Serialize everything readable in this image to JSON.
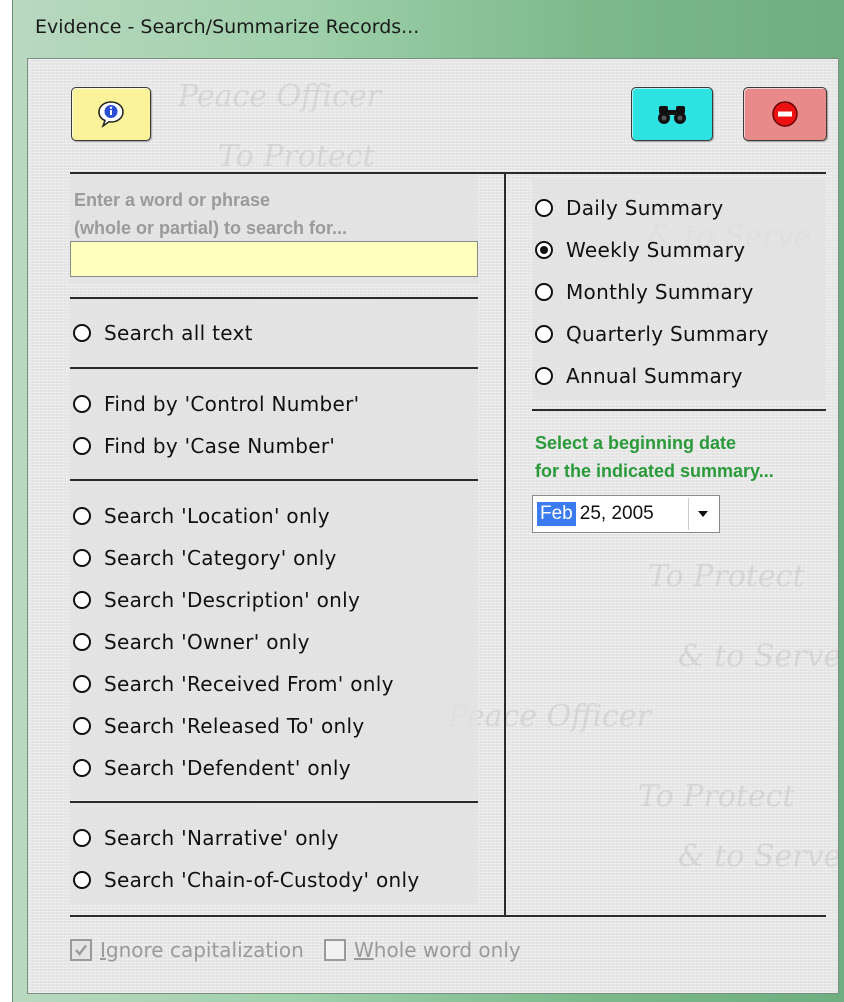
{
  "window": {
    "title": "Evidence - Search/Summarize Records..."
  },
  "toolbar": {
    "info_icon": "info-speech-bubble-icon",
    "find_icon": "binoculars-icon",
    "close_icon": "stop-sign-icon"
  },
  "search": {
    "hint": "Enter a word or phrase\n(whole or partial) to search for...",
    "value": "",
    "placeholder": ""
  },
  "options": {
    "group_all": [
      {
        "label": "Search all text",
        "selected": false
      }
    ],
    "group_numbers": [
      {
        "label": "Find by 'Control Number'",
        "selected": false
      },
      {
        "label": "Find by 'Case Number'",
        "selected": false
      }
    ],
    "group_fields": [
      {
        "label": "Search 'Location' only",
        "selected": false
      },
      {
        "label": "Search 'Category' only",
        "selected": false
      },
      {
        "label": "Search 'Description' only",
        "selected": false
      },
      {
        "label": "Search 'Owner' only",
        "selected": false
      },
      {
        "label": "Search 'Received From' only",
        "selected": false
      },
      {
        "label": "Search 'Released To' only",
        "selected": false
      },
      {
        "label": "Search 'Defendent' only",
        "selected": false
      }
    ],
    "group_text": [
      {
        "label": "Search 'Narrative' only",
        "selected": false
      },
      {
        "label": "Search 'Chain-of-Custody' only",
        "selected": false
      }
    ]
  },
  "summary": {
    "options": [
      {
        "label": "Daily Summary",
        "selected": false
      },
      {
        "label": "Weekly Summary",
        "selected": true
      },
      {
        "label": "Monthly Summary",
        "selected": false
      },
      {
        "label": "Quarterly Summary",
        "selected": false
      },
      {
        "label": "Annual Summary",
        "selected": false
      }
    ],
    "date_hint": "Select a beginning date\nfor the indicated summary...",
    "date_month": "Feb",
    "date_rest": "25, 2005"
  },
  "footer": {
    "ignore_caps_label": "Ignore capitalization",
    "ignore_caps_checked": true,
    "whole_word_label": "Whole word only",
    "whole_word_checked": false
  },
  "watermark": [
    "To Protect",
    "& to Serve",
    "Peace Officer"
  ],
  "colors": {
    "info_button": "#fbf39a",
    "find_button": "#2fe2e2",
    "close_button": "#e88a8a",
    "input_bg": "#ffffbe",
    "hint_green": "#2a9a3a",
    "date_highlight": "#3b7bf0"
  }
}
